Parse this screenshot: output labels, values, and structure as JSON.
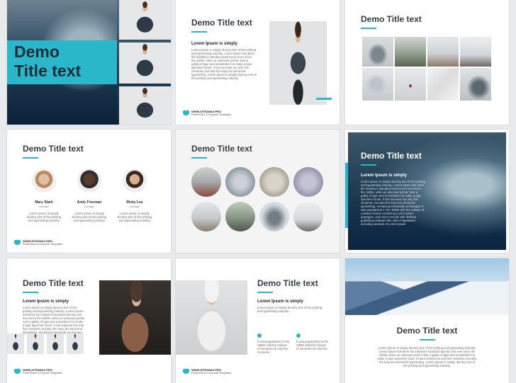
{
  "slides": {
    "s1": {
      "title_line1": "Demo",
      "title_line2": "Title text"
    },
    "s2": {
      "title": "Demo Title text",
      "subtitle": "Lorem Ipsum is simply",
      "body": "Lorem Ipsum is simply dummy text of the printing and typesetting industry. Lorem Ipsum has been the industry's standard dummy text ever since the 1500s, when an unknown printer took a galley of type and scrambled it to make a type specimen book. It has survived not only five centuries, but also the leap into electronic typesetting. Lorem Ipsum is simply dummy text of the printing and typesetting industry."
    },
    "s3": {
      "title": "Demo Title text"
    },
    "s4": {
      "title": "Demo Title text",
      "people": [
        {
          "name": "Mary Stark",
          "role": "manager",
          "desc": "Lorem Ipsum is simply dummy text of the printing and typesetting industry."
        },
        {
          "name": "Andy Freeman",
          "role": "manager",
          "desc": "Lorem Ipsum is simply dummy text of the printing and typesetting industry."
        },
        {
          "name": "Ricky Lee",
          "role": "manager",
          "desc": "Lorem Ipsum is simply dummy text of the printing and typesetting industry."
        }
      ]
    },
    "s5": {
      "title": "Demo Title text"
    },
    "s6": {
      "title": "Demo Title text",
      "subtitle": "Lorem Ipsum is simply",
      "body": "Lorem Ipsum is simply dummy text of the printing and typesetting industry. Lorem Ipsum has been the industry's standard dummy text ever since the 1500s, when an unknown printer took a galley of type and scrambled it to make a type specimen book. It has survived not only five centuries, but also the leap into electronic typesetting, remaining essentially unchanged. It was popularised in the 1960s with the release of Letraset sheets containing Lorem Ipsum passages, and more recently with desktop publishing software like Aldus PageMaker including versions of Lorem Ipsum."
    },
    "s7": {
      "title": "Demo Title text",
      "subtitle": "Lorem Ipsum is simply",
      "body": "Lorem Ipsum is simply dummy text of the printing and typesetting industry. Lorem Ipsum has been the industry's standard dummy text ever since the 1500s, when an unknown printer took a galley of type and scrambled it to make a type specimen book. It has survived not only five centuries, but also the leap into electronic typesetting, remaining essentially unchanged."
    },
    "s8": {
      "title": "Demo Title text",
      "subtitle": "Lorem Ipsum is simply",
      "body": "Lorem Ipsum is simply dummy text of the printing and typesetting industry.",
      "col1": "It was popularised in the 1960s with the release of survived not only five centuries.",
      "col2": "It was popularised in the 1960s with the release of survived not only five."
    },
    "s9": {
      "title": "Demo Title text",
      "body": "Lorem Ipsum is simply dummy text of the printing and typesetting industry. Lorem Ipsum has been the industry's standard dummy text ever since the 1500s, when an unknown printer took a galley of type and scrambled it to make a type specimen book. It has survived not only five centuries, but also the leap into electronic typesetting. Lorem Ipsum is simply dummy text of the printing and typesetting industry."
    }
  },
  "footer": {
    "brand": "WWW.SITE2MAX.PRO",
    "tagline": "PowerPoint & Keynote Templates"
  },
  "colors": {
    "accent": "#2ab7c9",
    "title": "#333d47",
    "deep_blue": "#1f3a52"
  }
}
